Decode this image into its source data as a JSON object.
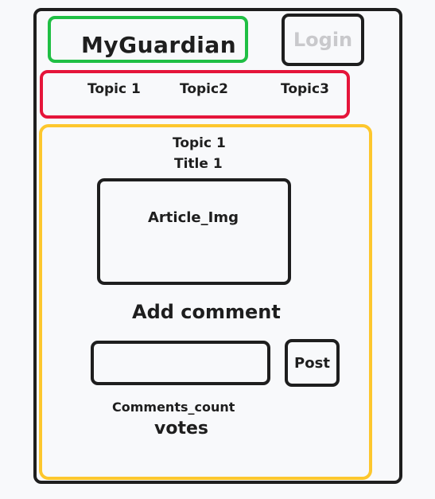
{
  "header": {
    "app_title": "MyGuardian",
    "login_label": "Login"
  },
  "nav": {
    "topics": [
      "Topic 1",
      "Topic2",
      "Topic3"
    ]
  },
  "article": {
    "topic": "Topic 1",
    "title": "Title 1",
    "image_label": "Article_Img"
  },
  "comments": {
    "heading": "Add comment",
    "input_value": "",
    "post_label": "Post",
    "count_label": "Comments_count",
    "votes_label": "votes"
  },
  "colors": {
    "logo_border": "#1fbf44",
    "nav_border": "#e5153a",
    "article_border": "#fdc72d",
    "stroke": "#1e1e1e",
    "login_text": "#c9c9cc",
    "background": "#f8f9fb"
  }
}
